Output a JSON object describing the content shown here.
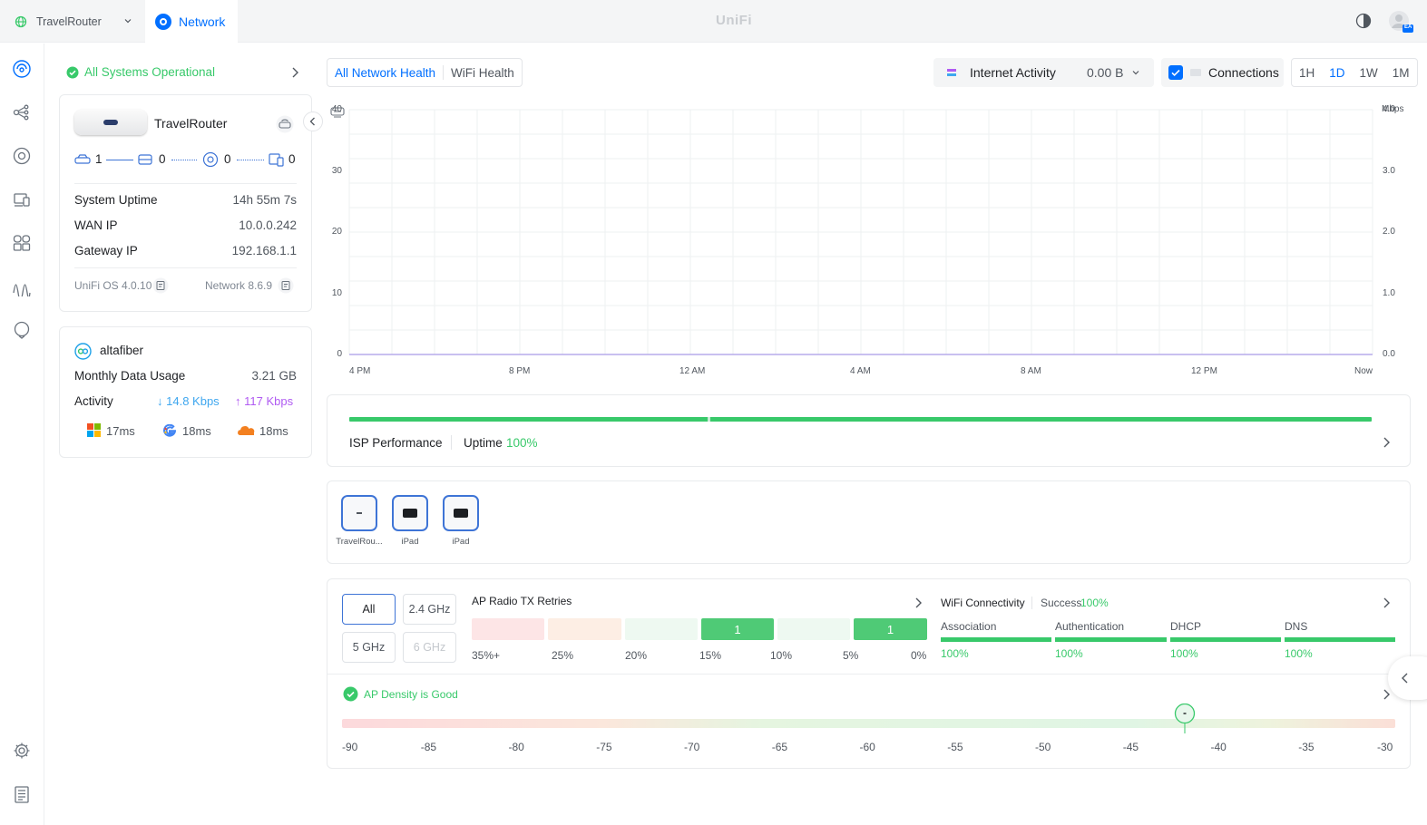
{
  "topbar": {
    "site_name": "TravelRouter",
    "app_tab": "Network",
    "logo": "UniFi",
    "avatar_initials": "EA"
  },
  "colors": {
    "accent": "#006fff",
    "success": "#38c96a",
    "upload": "#b05bf2",
    "download": "#3fa7ef"
  },
  "status": {
    "label": "All Systems Operational"
  },
  "gateway": {
    "name": "TravelRouter",
    "counts": {
      "wired": "1",
      "switches": "0",
      "aps": "0",
      "clients": "0"
    },
    "rows": [
      {
        "label": "System Uptime",
        "value": "14h 55m 7s"
      },
      {
        "label": "WAN IP",
        "value": "10.0.0.242"
      },
      {
        "label": "Gateway IP",
        "value": "192.168.1.1"
      }
    ],
    "os_version": "UniFi OS 4.0.10",
    "network_version": "Network 8.6.9"
  },
  "isp": {
    "name": "altafiber",
    "usage_label": "Monthly Data Usage",
    "usage_value": "3.21 GB",
    "activity_label": "Activity",
    "down": "14.8 Kbps",
    "up": "117 Kbps",
    "latencies": [
      {
        "icon": "microsoft-icon",
        "value": "17ms"
      },
      {
        "icon": "google-icon",
        "value": "18ms"
      },
      {
        "icon": "cloudflare-icon",
        "value": "18ms"
      }
    ]
  },
  "health_tabs": [
    "All Network Health",
    "WiFi Health"
  ],
  "chart_controls": {
    "metric_label": "Internet Activity",
    "metric_value": "0.00 B",
    "connections_label": "Connections",
    "ranges": [
      "1H",
      "1D",
      "1W",
      "1M"
    ],
    "active_range": "1D"
  },
  "chart_data": {
    "type": "line",
    "x_ticks": [
      "4 PM",
      "8 PM",
      "12 AM",
      "4 AM",
      "8 AM",
      "12 PM",
      "Now"
    ],
    "left_axis_ticks": [
      0,
      10,
      20,
      30,
      40
    ],
    "right_axis_ticks": [
      "0.0",
      "1.0",
      "2.0",
      "3.0",
      "4.0"
    ],
    "right_axis_unit": "Mbps",
    "ylim_left": [
      0,
      40
    ],
    "ylim_right": [
      0,
      4.0
    ],
    "grid": true,
    "series": [
      {
        "values": [
          0,
          0,
          0,
          0,
          0,
          0,
          0
        ]
      }
    ]
  },
  "isp_perf": {
    "label": "ISP Performance",
    "uptime_label": "Uptime",
    "uptime_value": "100%"
  },
  "topology": {
    "devices": [
      {
        "label": "TravelRou...",
        "type": "router"
      },
      {
        "label": "iPad",
        "type": "client"
      },
      {
        "label": "iPad",
        "type": "client"
      }
    ]
  },
  "radio": {
    "bands": [
      "All",
      "2.4 GHz",
      "5 GHz",
      "6 GHz"
    ],
    "active": "All",
    "disabled": "6 GHz",
    "tx_title": "AP Radio TX Retries",
    "tx_bins": [
      {
        "label": "35%+",
        "count": ""
      },
      {
        "label": "25%",
        "count": ""
      },
      {
        "label": "20%",
        "count": ""
      },
      {
        "label": "15%",
        "count": "1"
      },
      {
        "label": "10%",
        "count": ""
      },
      {
        "label": "5%",
        "count": "1"
      },
      {
        "label": "0%",
        "count": ""
      }
    ]
  },
  "wifi_conn": {
    "title": "WiFi Connectivity",
    "success_label": "Success",
    "success_value": "100%",
    "stages": [
      {
        "label": "Association",
        "value": "100%"
      },
      {
        "label": "Authentication",
        "value": "100%"
      },
      {
        "label": "DHCP",
        "value": "100%"
      },
      {
        "label": "DNS",
        "value": "100%"
      }
    ]
  },
  "density": {
    "label": "AP Density is Good",
    "scale": [
      "-90",
      "-85",
      "-80",
      "-75",
      "-70",
      "-65",
      "-60",
      "-55",
      "-50",
      "-45",
      "-40",
      "-35",
      "-30"
    ],
    "marker_dbm": -42
  }
}
